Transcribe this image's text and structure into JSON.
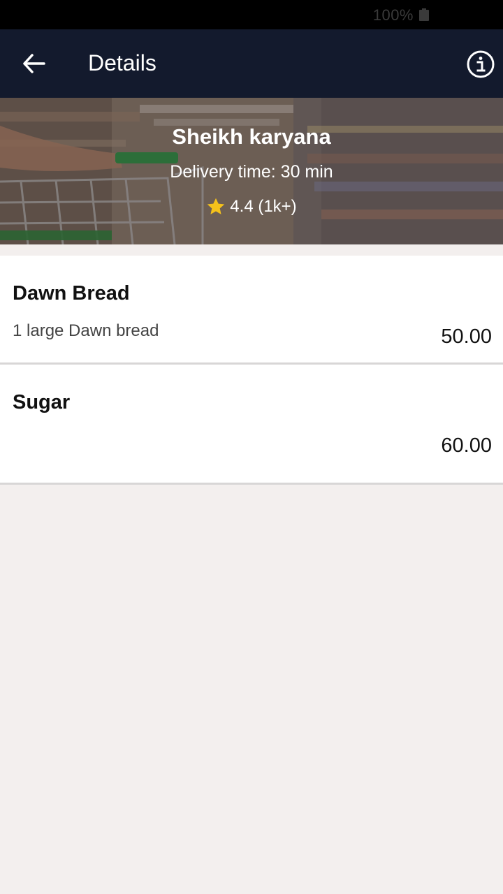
{
  "status_bar": {
    "battery_text": "100%"
  },
  "app_bar": {
    "title": "Details",
    "back_icon": "arrow-left-icon",
    "info_icon": "info-icon"
  },
  "store": {
    "name": "Sheikh karyana",
    "delivery_time": "Delivery time: 30 min",
    "rating": "4.4 (1k+)",
    "star_color": "#f5c21b"
  },
  "items": [
    {
      "name": "Dawn Bread",
      "description": "1 large Dawn bread",
      "price": "50.00"
    },
    {
      "name": "Sugar",
      "description": "",
      "price": "60.00"
    }
  ],
  "colors": {
    "app_bar": "#131a2d",
    "background": "#f3efee"
  }
}
